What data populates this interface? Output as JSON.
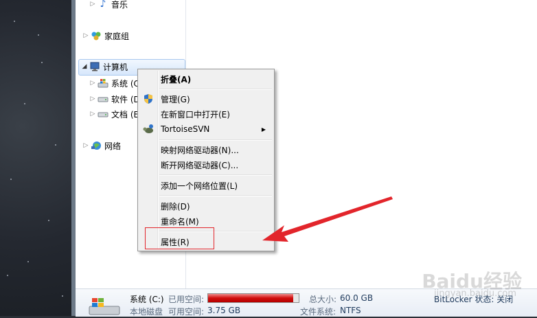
{
  "nav": {
    "items": [
      {
        "label": "音乐",
        "icon": "music-icon"
      },
      {
        "label": "家庭组",
        "icon": "homegroup-icon"
      },
      {
        "label": "计算机",
        "icon": "computer-icon"
      },
      {
        "label": "系统 (C",
        "icon": "drive-windows-icon"
      },
      {
        "label": "软件 (D",
        "icon": "drive-icon"
      },
      {
        "label": "文档 (E",
        "icon": "drive-icon"
      },
      {
        "label": "网络",
        "icon": "network-icon"
      }
    ]
  },
  "context_menu": {
    "items": [
      {
        "label": "折叠(A)",
        "bold": true
      },
      {
        "label": "管理(G)",
        "icon": "shield-icon"
      },
      {
        "label": "在新窗口中打开(E)"
      },
      {
        "label": "TortoiseSVN",
        "icon": "tortoise-icon",
        "submenu": true
      },
      {
        "label": "映射网络驱动器(N)..."
      },
      {
        "label": "断开网络驱动器(C)..."
      },
      {
        "label": "添加一个网络位置(L)"
      },
      {
        "label": "删除(D)"
      },
      {
        "label": "重命名(M)"
      },
      {
        "label": "属性(R)"
      }
    ]
  },
  "status_bar": {
    "drive_name": "系统 (C:)",
    "drive_type": "本地磁盘",
    "used_label": "已用空间:",
    "free_label": "可用空间:",
    "free_value": "3.75 GB",
    "total_label": "总大小:",
    "total_value": "60.0 GB",
    "fs_label": "文件系统:",
    "fs_value": "NTFS",
    "bitlocker_text": "BitLocker 状态: 关闭",
    "used_fraction": 0.94,
    "bar_color": "#d10d0d"
  },
  "watermark": {
    "logo_text": "Baidu经验",
    "url": "jingyan.baidu.com"
  },
  "colors": {
    "selection": "#d7e7fb",
    "highlight_box": "#e2252b",
    "arrow": "#e2252b"
  }
}
